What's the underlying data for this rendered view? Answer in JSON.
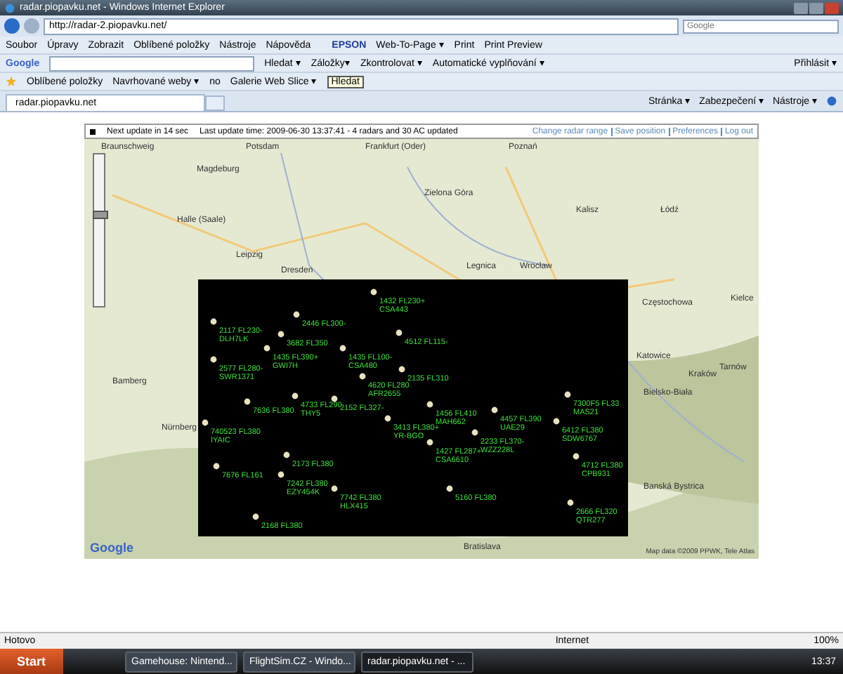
{
  "window": {
    "title": "radar.piopavku.net - Windows Internet Explorer"
  },
  "address_bar": {
    "url": "http://radar-2.piopavku.net/",
    "search_placeholder": "Google"
  },
  "menu": [
    "Soubor",
    "Úpravy",
    "Zobrazit",
    "Oblíbené položky",
    "Nástroje",
    "Nápověda"
  ],
  "epson_toolbar": {
    "brand": "EPSON",
    "items": [
      "Web-To-Page ▾",
      "Print",
      "Print Preview"
    ]
  },
  "google_toolbar": {
    "logo": "Google",
    "search_button": "Hledat ▾",
    "items": [
      "Záložky▾",
      "Zkontrolovat ▾",
      "Automatické vyplňování ▾"
    ],
    "login": "Přihlásit ▾"
  },
  "favorites_bar": {
    "label": "Oblíbené položky",
    "items": [
      "Navrhované weby ▾",
      "no",
      "Galerie Web Slice ▾"
    ],
    "tooltip": "Hledat"
  },
  "tabs": [
    {
      "label": "radar.piopavku.net",
      "selected": true
    }
  ],
  "command_bar": [
    "Stránka ▾",
    "Zabezpečení ▾",
    "Nástroje ▾"
  ],
  "radar_status": {
    "countdown": "Next update in 14 sec",
    "last_update": "Last update time: 2009-06-30 13:37:41 - 4 radars and 30 AC updated",
    "links": [
      "Change radar range",
      "Save position",
      "Preferences",
      "Log out"
    ]
  },
  "map": {
    "logo": "Google",
    "attribution": "Map data ©2009 PPWK, Tele Atlas",
    "cities": [
      "Braunschweig",
      "Potsdam",
      "Frankfurt (Oder)",
      "Poznań",
      "Magdeburg",
      "Zielona Góra",
      "Kalisz",
      "Łódź",
      "Halle (Saale)",
      "Leipzig",
      "Legnica",
      "Wrocław",
      "Dresden",
      "Częstochowa",
      "Kielce",
      "Katowice",
      "Kraków",
      "Tarnów",
      "Bielsko-Biała",
      "Banská Bystrica",
      "Bamberg",
      "Nürnberg",
      "Bratislava"
    ]
  },
  "aircraft": [
    {
      "label": "1432 FL230+",
      "callsign": "CSA443"
    },
    {
      "label": "2117 FL230-",
      "callsign": "DLH7LK"
    },
    {
      "label": "2446 FL300-"
    },
    {
      "label": "3682 FL350"
    },
    {
      "label": "1435 FL390+",
      "callsign": "GWI7H"
    },
    {
      "label": "1435 FL100-",
      "callsign": "CSA480"
    },
    {
      "label": "4512 FL115-"
    },
    {
      "label": "2577 FL280-",
      "callsign": "SWR1371"
    },
    {
      "label": "2135 FL310"
    },
    {
      "label": "4620 FL280",
      "callsign": "AFR2655"
    },
    {
      "label": "7636 FL380"
    },
    {
      "label": "4733 FL290",
      "callsign": "THY5"
    },
    {
      "label": "2152 FL327-"
    },
    {
      "label": "1456 FL410",
      "callsign": "MAH662"
    },
    {
      "label": "740523 FL380",
      "callsign": "IYAIC"
    },
    {
      "label": "3413 FL380+",
      "callsign": "YR-BGO"
    },
    {
      "label": "4457 FL390",
      "callsign": "UAE29"
    },
    {
      "label": "1427 FL287+",
      "callsign": "CSA6610"
    },
    {
      "label": "2233 FL370-",
      "callsign": "WZZ228L"
    },
    {
      "label": "7300F5 FL33",
      "callsign": "MAS21"
    },
    {
      "label": "6412 FL380",
      "callsign": "SDW6767"
    },
    {
      "label": "2173 FL380"
    },
    {
      "label": "4712 FL380",
      "callsign": "CPB931"
    },
    {
      "label": "7242 FL380",
      "callsign": "EZY454K"
    },
    {
      "label": "7742 FL380",
      "callsign": "HLX415"
    },
    {
      "label": "7676 FL161"
    },
    {
      "label": "5160 FL380"
    },
    {
      "label": "2666 FL320",
      "callsign": "QTR277"
    },
    {
      "label": "2168 FL380"
    }
  ],
  "zoom_control": {
    "level": 0.6
  },
  "status_bar": {
    "text": "Hotovo",
    "zone": "Internet",
    "zoom": "100%"
  },
  "taskbar": {
    "start": "Start",
    "tasks": [
      {
        "label": "Gamehouse: Nintend...",
        "selected": false
      },
      {
        "label": "FlightSim.CZ - Windo...",
        "selected": false
      },
      {
        "label": "radar.piopavku.net - ...",
        "selected": true
      }
    ],
    "clock": "13:37"
  }
}
